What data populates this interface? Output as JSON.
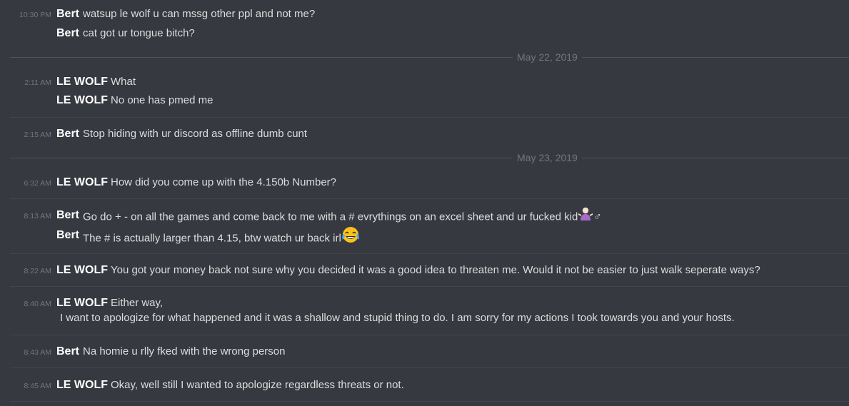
{
  "messages": [
    {
      "time": "10:30 PM",
      "author": "Bert",
      "text": "watsup le wolf u can mssg other ppl and not me?"
    },
    {
      "author": "Bert",
      "text": "cat got ur tongue bitch?"
    },
    {
      "time": "2:11 AM",
      "author": "LE WOLF",
      "text": "What"
    },
    {
      "author": "LE WOLF",
      "text": "No one has pmed me"
    },
    {
      "time": "2:15 AM",
      "author": "Bert",
      "text": "Stop hiding with ur discord as offline dumb cunt"
    },
    {
      "time": "6:32 AM",
      "author": "LE WOLF",
      "text": "How did you come up with the 4.150b Number?"
    },
    {
      "time": "8:13 AM",
      "author": "Bert",
      "text": "Go do + - on all the games and come back to me with a # evrythings on an excel sheet and ur fucked kid",
      "emoji": "person-shrugging-emoji",
      "emoji_suffix": "♂"
    },
    {
      "author": "Bert",
      "text": "The # is actually larger than 4.15, btw watch ur back irl",
      "emoji": "face-with-tears-of-joy-emoji"
    },
    {
      "time": "8:22 AM",
      "author": "LE WOLF",
      "text": "You got your money back not sure why you decided it was a good idea to threaten me. Would it not be easier to just walk seperate ways?"
    },
    {
      "time": "8:40 AM",
      "author": "LE WOLF",
      "text": "Either way,"
    },
    {
      "author": "LE WOLF",
      "text": "I want to apologize for what happened and it was a shallow and stupid thing to do. I am sorry for my actions I took towards you and your hosts."
    },
    {
      "time": "8:43 AM",
      "author": "Bert",
      "text": "Na homie u rlly fked with the wrong person"
    },
    {
      "time": "8:45 AM",
      "author": "LE WOLF",
      "text": "Okay, well still I wanted to apologize regardless threats or not."
    }
  ],
  "date_separators": [
    "May 22, 2019",
    "May 23, 2019"
  ],
  "colors": {
    "background": "#36393f",
    "author": "#ffffff",
    "text": "#dcddde",
    "timestamp": "#72767d",
    "divider": "#42454a"
  }
}
